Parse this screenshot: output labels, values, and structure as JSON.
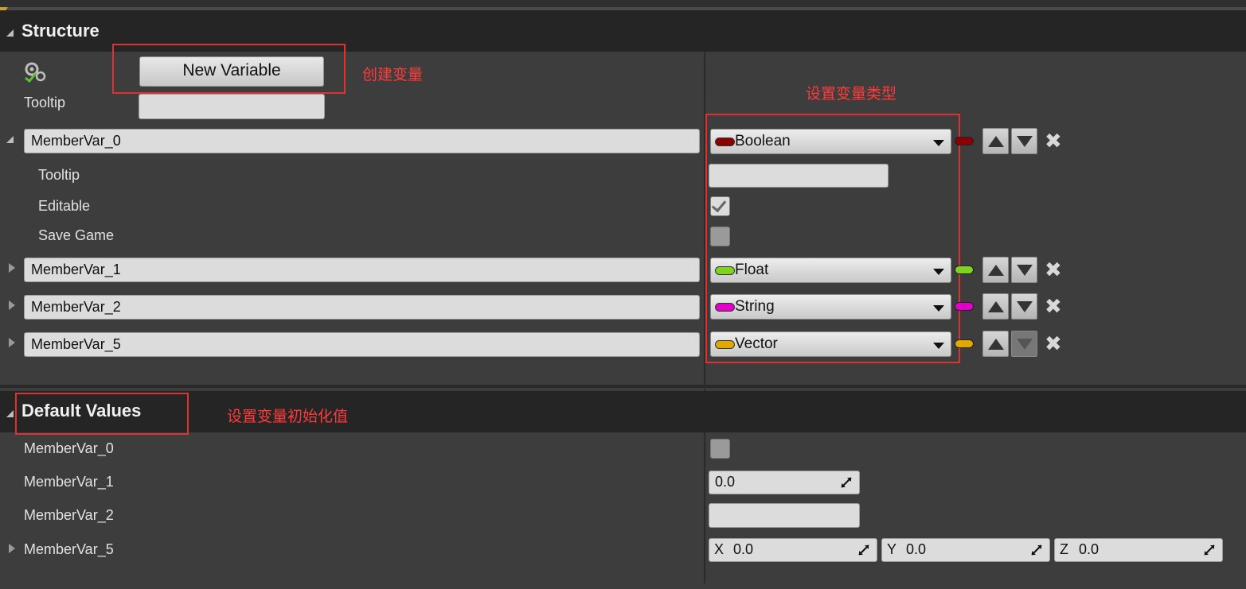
{
  "structure": {
    "title": "Structure",
    "new_variable_label": "New Variable",
    "tooltip_label": "Tooltip",
    "tooltip_value": "",
    "variables": [
      {
        "name": "MemberVar_0",
        "type": "Boolean",
        "type_color": "#8b0000",
        "expanded": true
      },
      {
        "name": "MemberVar_1",
        "type": "Float",
        "type_color": "#7fd320",
        "expanded": false
      },
      {
        "name": "MemberVar_2",
        "type": "String",
        "type_color": "#e000c8",
        "expanded": false
      },
      {
        "name": "MemberVar_5",
        "type": "Vector",
        "type_color": "#e0a800",
        "expanded": false
      }
    ],
    "member0_details": {
      "tooltip_label": "Tooltip",
      "tooltip_value": "",
      "editable_label": "Editable",
      "editable_checked": true,
      "save_game_label": "Save Game",
      "save_game_checked": false
    },
    "close_glyph": "✖"
  },
  "default_values": {
    "title": "Default Values",
    "rows": [
      {
        "name": "MemberVar_0",
        "kind": "checkbox",
        "checked": false
      },
      {
        "name": "MemberVar_1",
        "kind": "number",
        "value": "0.0"
      },
      {
        "name": "MemberVar_2",
        "kind": "text",
        "value": ""
      },
      {
        "name": "MemberVar_5",
        "kind": "vector",
        "x_label": "X",
        "x_value": "0.0",
        "y_label": "Y",
        "y_value": "0.0",
        "z_label": "Z",
        "z_value": "0.0"
      }
    ]
  },
  "annotations": {
    "create_variable": "创建变量",
    "set_variable_type": "设置变量类型",
    "set_initial_value": "设置变量初始化值"
  }
}
